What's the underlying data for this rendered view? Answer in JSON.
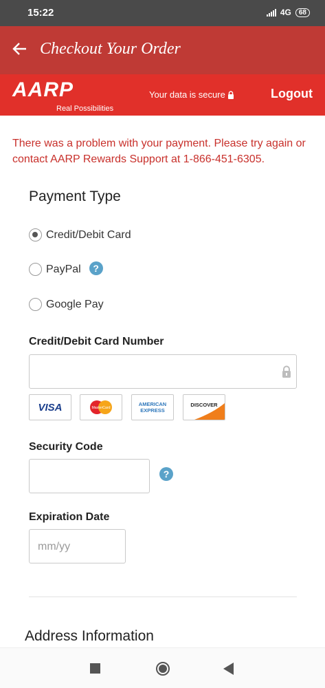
{
  "status_bar": {
    "time": "15:22",
    "network": "4G",
    "battery": "68"
  },
  "app_bar": {
    "title": "Checkout Your Order"
  },
  "brand": {
    "logo_text": "AARP",
    "tagline": "Real Possibilities",
    "secure_text": "Your data is secure",
    "logout_label": "Logout"
  },
  "error_message": "There was a problem with your payment. Please try again or contact AARP Rewards Support at 1-866-451-6305.",
  "payment_type": {
    "title": "Payment Type",
    "options": [
      {
        "label": "Credit/Debit Card",
        "checked": true
      },
      {
        "label": "PayPal",
        "checked": false
      },
      {
        "label": "Google Pay",
        "checked": false
      }
    ]
  },
  "card_number": {
    "label": "Credit/Debit Card Number",
    "value": "",
    "placeholder": ""
  },
  "card_logos": [
    "VISA",
    "MasterCard",
    "AMERICAN EXPRESS",
    "DISCOVER"
  ],
  "security_code": {
    "label": "Security Code",
    "value": ""
  },
  "expiration": {
    "label": "Expiration Date",
    "placeholder": "mm/yy"
  },
  "address": {
    "title": "Address Information"
  },
  "colors": {
    "app_bar": "#bf3a35",
    "brand_bar": "#e1302a",
    "error": "#c8302b",
    "help": "#5aa2c9"
  }
}
